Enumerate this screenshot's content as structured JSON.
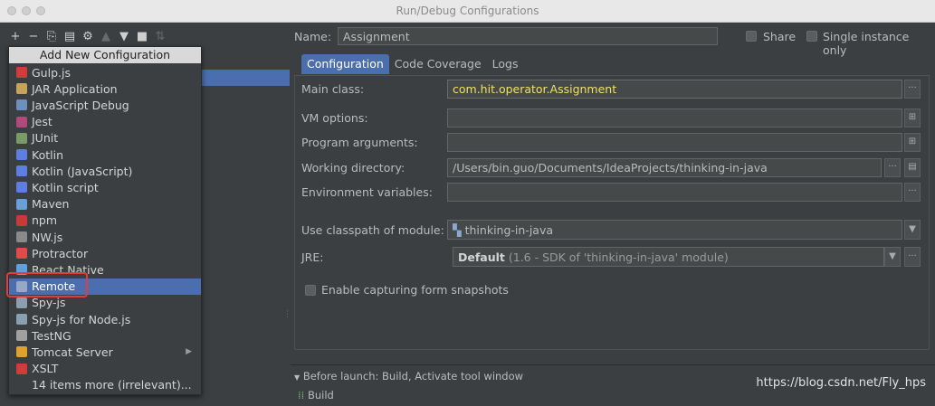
{
  "window": {
    "title": "Run/Debug Configurations"
  },
  "toolbar": {
    "icons": [
      "add-icon",
      "remove-icon",
      "copy-icon",
      "save-icon",
      "wrench-icon",
      "move-up-icon",
      "move-down-icon",
      "folder-icon",
      "sort-icon"
    ],
    "glyphs": [
      "+",
      "−",
      "⎘",
      "▤",
      "⚙",
      "▲",
      "▼",
      "■",
      "⇅"
    ]
  },
  "popup": {
    "header": "Add New Configuration",
    "items": [
      {
        "label": "Gulp.js",
        "color": "#d03c3c",
        "selected": false
      },
      {
        "label": "JAR Application",
        "color": "#c8a45a",
        "selected": false
      },
      {
        "label": "JavaScript Debug",
        "color": "#6b8fbf",
        "selected": false
      },
      {
        "label": "Jest",
        "color": "#b04a7a",
        "selected": false
      },
      {
        "label": "JUnit",
        "color": "#7a9a6a",
        "selected": false
      },
      {
        "label": "Kotlin",
        "color": "#5c7fe0",
        "selected": false
      },
      {
        "label": "Kotlin (JavaScript)",
        "color": "#5c7fe0",
        "selected": false
      },
      {
        "label": "Kotlin script",
        "color": "#5c7fe0",
        "selected": false
      },
      {
        "label": "Maven",
        "color": "#6aa0d8",
        "selected": false
      },
      {
        "label": "npm",
        "color": "#c83a3a",
        "selected": false
      },
      {
        "label": "NW.js",
        "color": "#8a8a8a",
        "selected": false
      },
      {
        "label": "Protractor",
        "color": "#e04a4a",
        "selected": false
      },
      {
        "label": "React Native",
        "color": "#61a0d8",
        "selected": false
      },
      {
        "label": "Remote",
        "color": "#9aa8c8",
        "selected": true
      },
      {
        "label": "Spy-js",
        "color": "#8aa0b0",
        "selected": false
      },
      {
        "label": "Spy-js for Node.js",
        "color": "#8aa0b0",
        "selected": false
      },
      {
        "label": "TestNG",
        "color": "#a0a0a0",
        "selected": false
      },
      {
        "label": "Tomcat Server",
        "color": "#e0a030",
        "selected": false,
        "submenu": true
      },
      {
        "label": "XSLT",
        "color": "#d03c3c",
        "selected": false
      },
      {
        "label": "14 items more (irrelevant)...",
        "color": "",
        "selected": false
      }
    ]
  },
  "form": {
    "name_label": "Name:",
    "name_value": "Assignment",
    "share_label": "Share",
    "single_instance_label": "Single instance only",
    "tabs": [
      "Configuration",
      "Code Coverage",
      "Logs"
    ],
    "main_class_label": "Main class:",
    "main_class_value": "com.hit.operator.Assignment",
    "vm_options_label": "VM options:",
    "vm_options_value": "",
    "program_args_label": "Program arguments:",
    "program_args_value": "",
    "working_dir_label": "Working directory:",
    "working_dir_value": "/Users/bin.guo/Documents/IdeaProjects/thinking-in-java",
    "env_vars_label": "Environment variables:",
    "env_vars_value": "",
    "classpath_label": "Use classpath of module:",
    "classpath_value": "thinking-in-java",
    "jre_label": "JRE:",
    "jre_value_bold": "Default",
    "jre_value_rest": " (1.6 - SDK of 'thinking-in-java' module)",
    "enable_snapshots_label": "Enable capturing form snapshots",
    "before_launch_label": "Before launch: Build, Activate tool window",
    "build_label": "Build"
  },
  "watermark": "https://blog.csdn.net/Fly_hps"
}
